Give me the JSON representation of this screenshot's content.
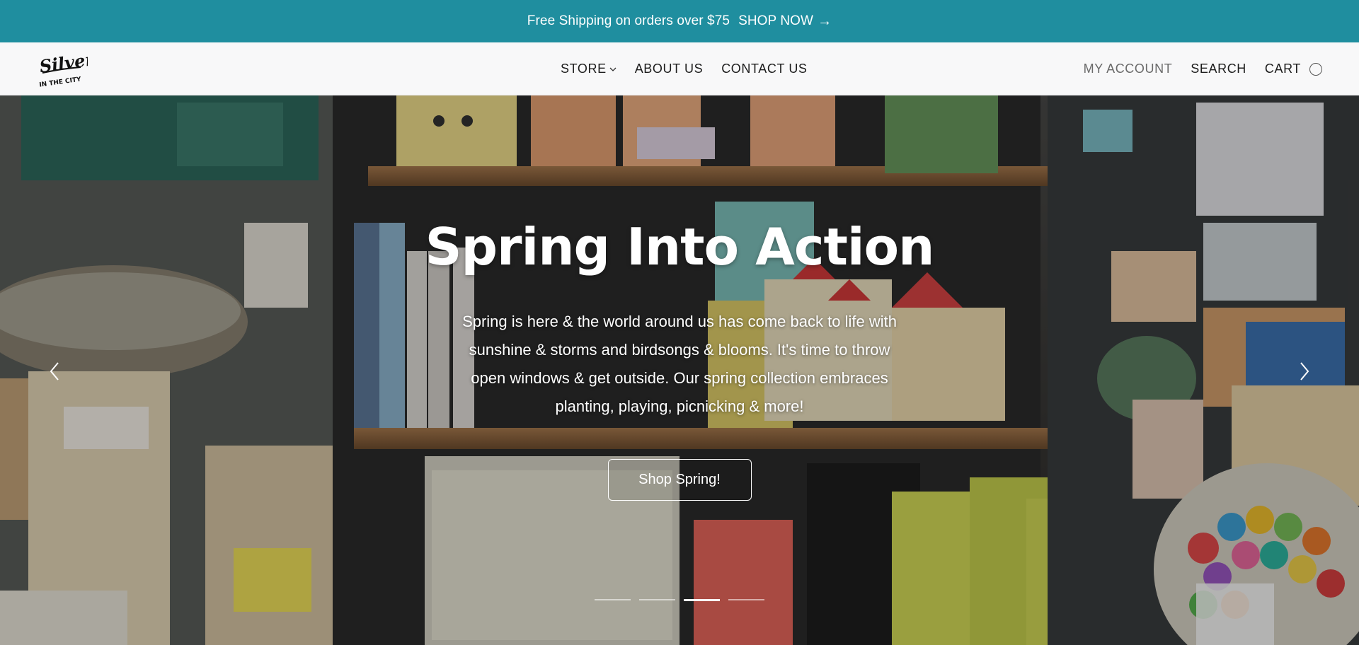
{
  "announcement": {
    "message": "Free Shipping on orders over $75",
    "cta_label": "SHOP NOW",
    "background_color": "#1f8e9f"
  },
  "header": {
    "logo_alt": "Silver in the City",
    "nav": [
      {
        "label": "STORE",
        "has_dropdown": true
      },
      {
        "label": "ABOUT US"
      },
      {
        "label": "CONTACT US"
      }
    ],
    "right_nav": {
      "account_label": "MY ACCOUNT",
      "search_label": "SEARCH",
      "cart_label": "CART"
    }
  },
  "hero": {
    "title": "Spring Into Action",
    "text": "Spring is here & the world around us has come back to life with sunshine & storms and birdsongs & blooms. It's time to throw open windows & get outside. Our spring collection embraces planting, playing, picnicking & more!",
    "button_label": "Shop Spring!",
    "slides_total": 4,
    "active_slide": 3
  },
  "icons": {
    "arrow_prev": "chevron-left-icon",
    "arrow_next": "chevron-right-icon",
    "dropdown": "chevron-down-icon",
    "cart": "cart-count-icon",
    "cta_arrow": "arrow-right-icon"
  }
}
